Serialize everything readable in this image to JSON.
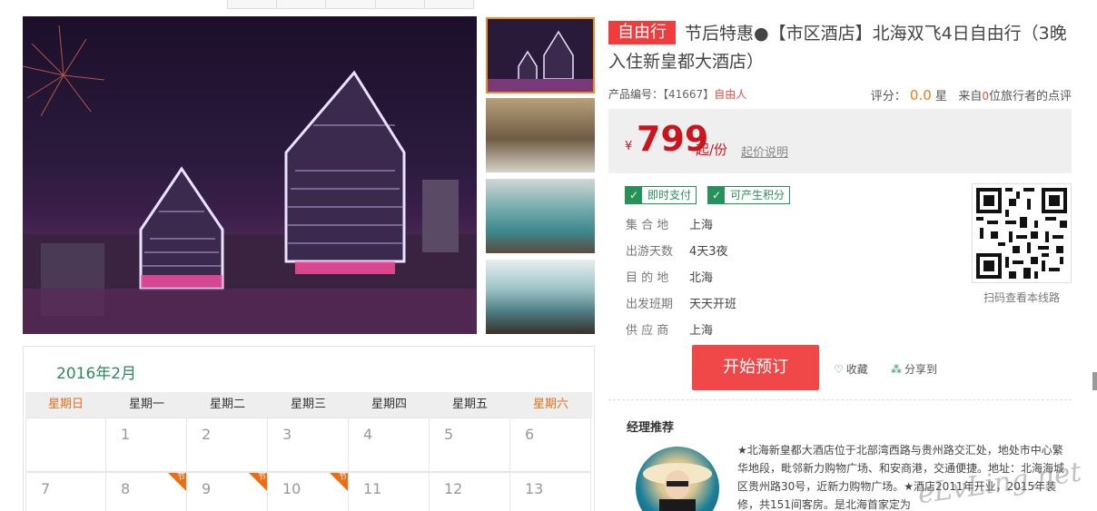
{
  "product": {
    "badge": "自由行",
    "title": "节后特惠●【市区酒店】北海双飞4日自由行（3晚入住新皇都大酒店）",
    "code_label": "产品编号：",
    "code_value": "【41667】",
    "code_type": "自由人",
    "rating_label": "评分：",
    "rating_score": "0.0",
    "rating_unit": "星",
    "reviews_prefix": "来自",
    "reviews_count": "0",
    "reviews_suffix": "位旅行者的点评"
  },
  "price": {
    "currency": "¥",
    "amount": "799",
    "unit": "起/份",
    "explain_link": "起价说明"
  },
  "tags": [
    "即时支付",
    "可产生积分"
  ],
  "info": [
    {
      "label": "集 合 地",
      "value": "上海"
    },
    {
      "label": "出游天数",
      "value": "4天3夜"
    },
    {
      "label": "目 的 地",
      "value": "北海"
    },
    {
      "label": "出发班期",
      "value": "天天开班"
    },
    {
      "label": "供 应 商",
      "value": "上海"
    }
  ],
  "qr_caption": "扫码查看本线路",
  "actions": {
    "book": "开始预订",
    "favorite": "收藏",
    "share": "分享到"
  },
  "manager": {
    "title": "经理推荐",
    "text": "★北海新皇都大酒店位于北部湾西路与贵州路交汇处，地处市中心繁华地段，毗邻新力购物广场、和安商港，交通便捷。地址：北海海城区贵州路30号，近新力购物广场。★酒店2011年开业，2015年装修，共151间客房。是北海首家定为"
  },
  "calendar": {
    "title": "2016年2月",
    "weekdays": [
      "星期日",
      "星期一",
      "星期二",
      "星期三",
      "星期四",
      "星期五",
      "星期六"
    ],
    "row1": [
      "",
      "1",
      "2",
      "3",
      "4",
      "5",
      "6"
    ],
    "row2": [
      "7",
      "8",
      "9",
      "10",
      "11",
      "12",
      "13"
    ],
    "holiday_mark": "节"
  },
  "watermark": "eLvLing.net",
  "colors": {
    "accent_red": "#f04848",
    "price_red": "#c9151e",
    "green": "#27915a",
    "orange": "#ec6d14"
  }
}
